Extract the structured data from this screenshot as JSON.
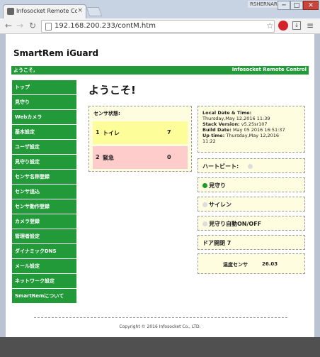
{
  "browser": {
    "tab_title": "Infosocket Remote Con",
    "tab_close": "×",
    "user_badge": "RSHERNARI",
    "url": "192.168.200.233/contM.htm",
    "win_min": "─",
    "win_max": "□",
    "win_close": "✕",
    "icons": [
      "back-icon",
      "forward-icon",
      "reload-icon",
      "page-icon",
      "star-icon",
      "extension-icon",
      "download-icon",
      "menu-icon"
    ]
  },
  "header": {
    "app_title": "SmartRem iGuard",
    "greeting": "ようこそ,",
    "brand": "Infosocket Remote Control",
    "accent_color": "#229a3a"
  },
  "sidebar": {
    "items": [
      {
        "label": "トップ"
      },
      {
        "label": "見守り"
      },
      {
        "label": "Webカメラ"
      },
      {
        "label": "基本設定"
      },
      {
        "label": "ユーザ設定"
      },
      {
        "label": "見守り設定"
      },
      {
        "label": "センサ名称登録"
      },
      {
        "label": "センサ追込"
      },
      {
        "label": "センサ動作登録"
      },
      {
        "label": "カメラ登録"
      },
      {
        "label": "管理者設定"
      },
      {
        "label": "ダイナミックDNS"
      },
      {
        "label": "メール設定"
      },
      {
        "label": "ネットワーク設定"
      },
      {
        "label": "SmartRemについて"
      }
    ]
  },
  "main": {
    "welcome": "ようこそ!",
    "sensors": {
      "title": "センサ状態:",
      "rows": [
        {
          "num": "1",
          "name": "トイレ",
          "value": "7",
          "color": "#fdfd9a"
        },
        {
          "num": "2",
          "name": "緊急",
          "value": "0",
          "color": "#ffcccc"
        }
      ]
    },
    "info": {
      "local_date_label": "Local Date & Time:",
      "local_date_value": "Thursday,May 12,2016 11:39",
      "stack_label": "Stack Version:",
      "stack_value": "v5.25sr107",
      "build_label": "Build Date:",
      "build_value": "May 05 2016 16:51:37",
      "uptime_label": "Up time:",
      "uptime_value": "Thursday,May 12,2016",
      "uptime_value2": "11:22"
    },
    "status": {
      "heartbeat": "ハートビート:",
      "watch": "見守り",
      "siren": "サイレン",
      "auto_watch": "見守り自動ON/OFF",
      "door": "ドア開閉 7"
    },
    "temperature": {
      "label": "温度センサ",
      "value": "26.03"
    }
  },
  "footer": {
    "copyright": "Copyright © 2016 Infosocket Co., LTD."
  }
}
